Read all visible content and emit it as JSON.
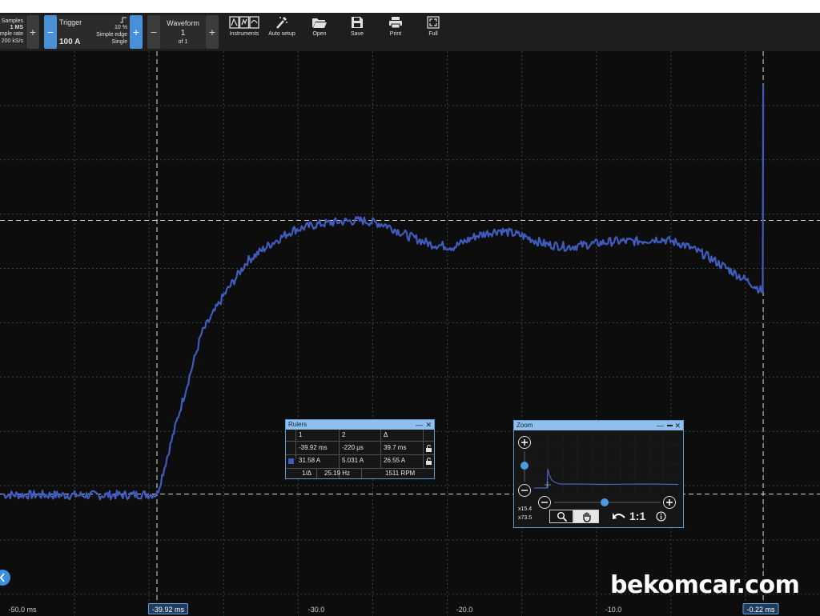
{
  "toolbar": {
    "samples": {
      "lines": [
        "Samples",
        "1 MS",
        "imple rate",
        "200 kS/s"
      ],
      "minus": "−",
      "plus": "+"
    },
    "trigger": {
      "title": "Trigger",
      "value": "100 A",
      "percent": "10 %",
      "mode": "Simple edge",
      "repeat": "Single",
      "minus": "−",
      "plus": "+"
    },
    "waveform": {
      "title": "Waveform",
      "number": "1",
      "of": "of 1",
      "minus": "−",
      "plus": "+"
    },
    "tools": [
      {
        "label": "Instruments",
        "icon": "instruments-icon"
      },
      {
        "label": "Auto setup",
        "icon": "auto-setup-icon"
      },
      {
        "label": "Open",
        "icon": "folder-open-icon"
      },
      {
        "label": "Save",
        "icon": "save-icon"
      },
      {
        "label": "Print",
        "icon": "print-icon"
      },
      {
        "label": "Full",
        "icon": "fullscreen-icon"
      }
    ]
  },
  "chart_data": {
    "type": "line",
    "series": [
      {
        "color": "#3f5bbd",
        "x": [
          -50.0,
          -45.0,
          -42.0,
          -40.0,
          -39.9,
          -38.5,
          -37.0,
          -35.5,
          -34.0,
          -32.5,
          -31.0,
          -29.5,
          -28.0,
          -26.5,
          -25.0,
          -23.5,
          -22.0,
          -20.5,
          -19.0,
          -17.5,
          -16.0,
          -14.5,
          -13.0,
          -11.5,
          -10.0,
          -8.5,
          -7.0,
          -5.5,
          -4.0,
          -2.5,
          -1.0,
          -0.25,
          -0.22
        ],
        "y": [
          31.4,
          31.2,
          31.3,
          31.6,
          31.8,
          60.0,
          89.0,
          103.0,
          115.0,
          121.0,
          126.0,
          128.0,
          129.0,
          129.5,
          128.0,
          124.0,
          121.0,
          120.0,
          124.0,
          126.0,
          124.0,
          121.0,
          120.0,
          121.0,
          122.0,
          122.0,
          123.0,
          121.0,
          117.0,
          112.0,
          107.0,
          104.0,
          178.0
        ]
      }
    ],
    "x_ticks": [
      "-50.0 ms",
      "-30.0",
      "-20.0",
      "-10.0"
    ],
    "xlim": [
      -50.2,
      3.5
    ],
    "ylim": [
      -12,
      190
    ],
    "grid": true,
    "rulers_x": [
      -39.92,
      -0.22
    ],
    "rulers_y": [
      31.58,
      129.5
    ]
  },
  "ruler_tags": {
    "left": "-39.92 ms",
    "right": "-0.22 ms"
  },
  "nav_icon": "chevron-left-icon",
  "rulers_panel": {
    "title": "Rulers",
    "min": "—",
    "close": "✕",
    "headers": [
      "1",
      "2",
      "Δ"
    ],
    "time_row": [
      "-39.92 ms",
      "-220 µs",
      "39.7 ms"
    ],
    "amp_row": [
      "31.58 A",
      "5.031 A",
      "26.55 A"
    ],
    "freq_label": "1/Δ",
    "freq": "25.19 Hz",
    "rpm": "1511 RPM",
    "lock_icon": "lock-icon",
    "channel_color": "#3f5bbd"
  },
  "zoom_panel": {
    "title": "Zoom",
    "min": "—",
    "max": "▬",
    "close": "✕",
    "zoom_x": "x15.4",
    "zoom_y": "x73.5",
    "ratio": "1:1",
    "vertical_level": 0.45,
    "horizontal_level": 0.47,
    "icons": [
      "zoom-in-icon",
      "zoom-out-icon",
      "magnifier-icon",
      "pan-hand-icon",
      "undo-icon",
      "info-icon"
    ],
    "plus": "+",
    "minus": "−"
  },
  "watermark": "bekomcar.com"
}
